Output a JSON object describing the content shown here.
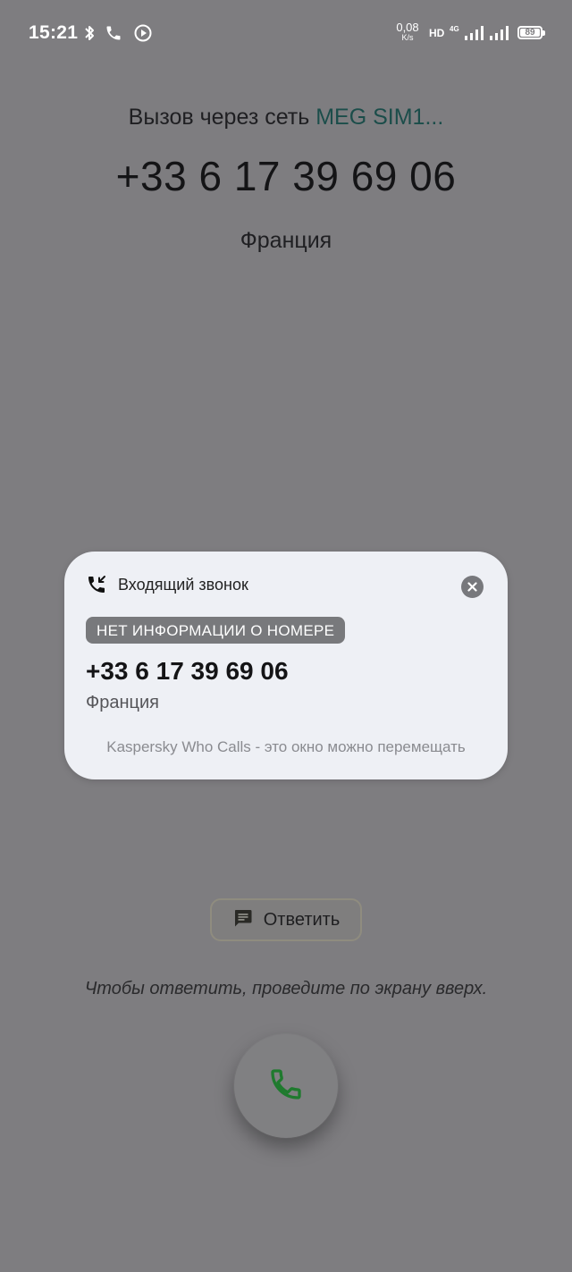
{
  "status_bar": {
    "time": "15:21",
    "net_speed_value": "0,08",
    "net_speed_unit": "K/s",
    "hd_label": "HD",
    "network_type": "4G",
    "battery": "89"
  },
  "call": {
    "via_prefix": "Вызов через сеть ",
    "sim_name": "MEG SIM1...",
    "number": "+33 6 17 39 69 06",
    "country": "Франция"
  },
  "popup": {
    "title": "Входящий звонок",
    "badge": "НЕТ ИНФОРМАЦИИ О НОМЕРЕ",
    "number": "+33 6 17 39 69 06",
    "country": "Франция",
    "footer": "Kaspersky Who Calls - это окно можно перемещать"
  },
  "actions": {
    "reply_label": "Ответить",
    "swipe_hint": "Чтобы ответить, проведите по экрану вверх."
  },
  "colors": {
    "background": "#7e7d80",
    "sim_accent": "#1b4d4a",
    "answer_green": "#1f7a2e",
    "card_bg": "#eef0f5"
  },
  "icons": {
    "status": [
      "bluetooth-icon",
      "phone-icon",
      "play-circle-icon",
      "signal-icon",
      "battery-icon"
    ],
    "popup": [
      "incoming-call-icon",
      "close-icon"
    ],
    "actions": [
      "message-icon",
      "answer-phone-icon"
    ]
  }
}
